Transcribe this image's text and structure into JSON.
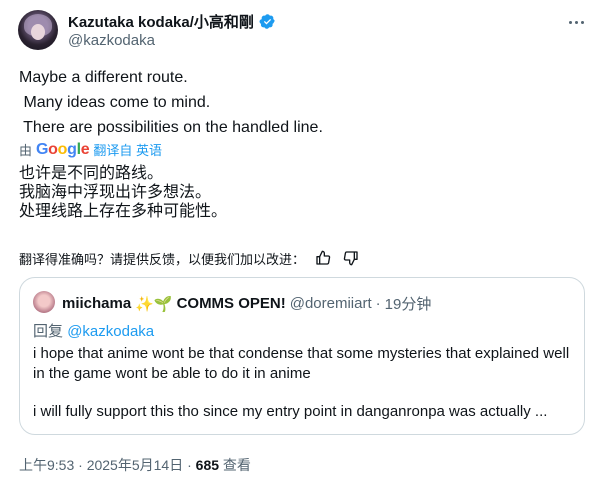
{
  "author": {
    "display_name": "Kazutaka kodaka/小高和剛",
    "handle": "@kazkodaka",
    "verified": true
  },
  "tweet": {
    "text": "Maybe a different route.\n Many ideas come to mind.\n There are possibilities on the handled line.",
    "translated_by_prefix": "由",
    "google_logo_text": "Google",
    "translate_link": "翻译自 英语",
    "translated_text": "也许是不同的路线。\n我脑海中浮现出许多想法。\n处理线路上存在多种可能性。",
    "feedback_prompt": "翻译得准确吗？请提供反馈，以便我们加以改进："
  },
  "quote": {
    "display_name": "miichama",
    "name_emojis": "✨🌱",
    "tag": "COMMS OPEN!",
    "handle": "@doremiiart",
    "separator": "·",
    "time": "19分钟",
    "reply_prefix": "回复",
    "reply_to": "@kazkodaka",
    "paragraph1": "i hope that anime wont be that condense that some mysteries that explained well in the game wont be able to do it in anime",
    "paragraph2": "i will fully support this tho since my entry point in danganronpa was actually ..."
  },
  "footer": {
    "time": "上午9:53",
    "sep1": "·",
    "date": "2025年5月14日",
    "sep2": "·",
    "views_count": "685",
    "views_label": "查看"
  },
  "colors": {
    "accent": "#1d9bf0",
    "muted": "#536471",
    "text": "#0f1419",
    "border": "#cfd9de"
  },
  "icons": [
    "verified-badge-icon",
    "more-options-icon",
    "thumbs-up-icon",
    "thumbs-down-icon"
  ]
}
